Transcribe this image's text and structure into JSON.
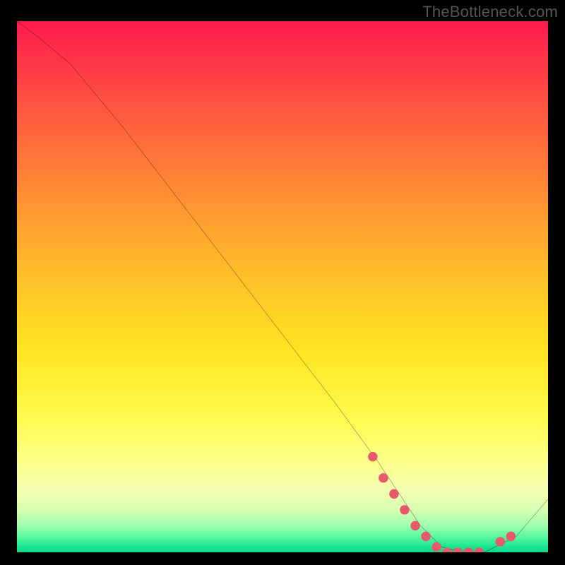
{
  "watermark": "TheBottleneck.com",
  "chart_data": {
    "type": "line",
    "title": "",
    "xlabel": "",
    "ylabel": "",
    "xlim": [
      0,
      100
    ],
    "ylim": [
      0,
      100
    ],
    "series": [
      {
        "name": "bottleneck-curve",
        "x": [
          0,
          4,
          10,
          20,
          30,
          40,
          50,
          60,
          68,
          72,
          76,
          80,
          84,
          88,
          90,
          94,
          100
        ],
        "y": [
          100,
          97,
          92,
          80,
          67,
          54,
          41,
          28,
          17,
          11,
          5,
          1,
          0,
          0,
          1,
          3,
          10
        ]
      }
    ],
    "markers": {
      "name": "highlight-points",
      "color": "#e85a6b",
      "x": [
        67,
        69,
        71,
        73,
        75,
        77,
        79,
        81,
        83,
        85,
        87,
        91,
        93
      ],
      "y": [
        18,
        14,
        11,
        8,
        5,
        3,
        1,
        0,
        0,
        0,
        0,
        2,
        3
      ]
    }
  }
}
